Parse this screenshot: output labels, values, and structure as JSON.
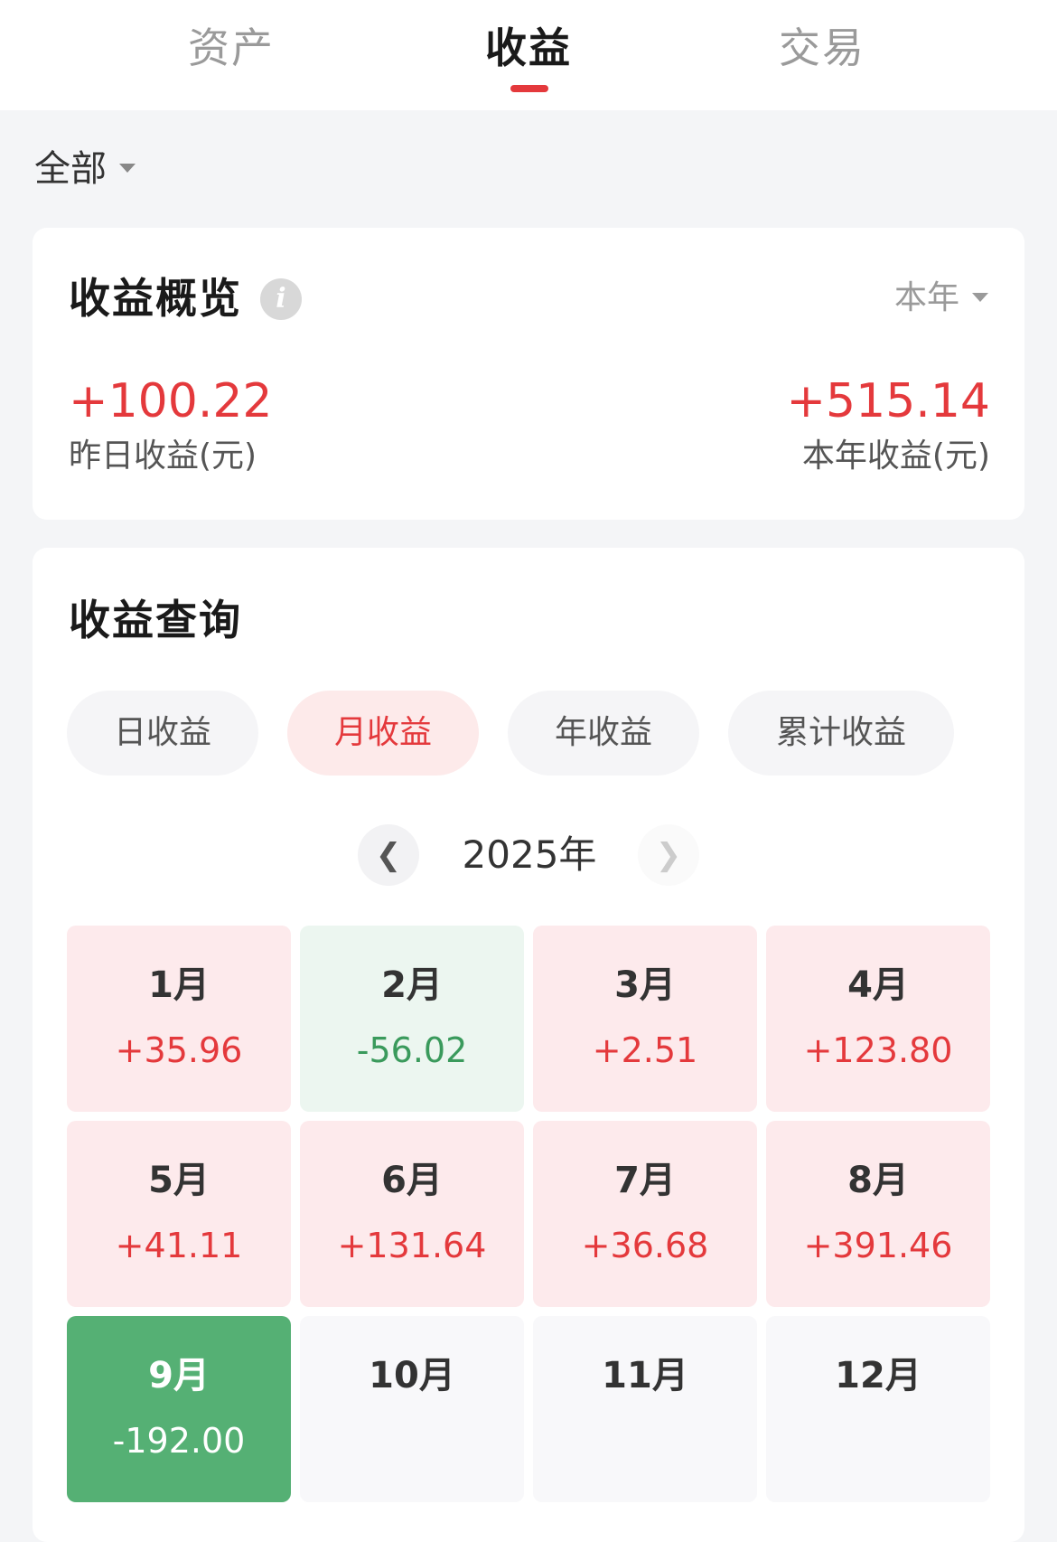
{
  "tabs": [
    {
      "label": "资产",
      "active": false
    },
    {
      "label": "收益",
      "active": true
    },
    {
      "label": "交易",
      "active": false
    }
  ],
  "filter": {
    "label": "全部"
  },
  "overview": {
    "title": "收益概览",
    "info_icon": "info-icon",
    "period": "本年",
    "yesterday": {
      "value": "+100.22",
      "label": "昨日收益(元)"
    },
    "this_year": {
      "value": "+515.14",
      "label": "本年收益(元)"
    }
  },
  "query": {
    "title": "收益查询",
    "pills": [
      {
        "label": "日收益",
        "active": false
      },
      {
        "label": "月收益",
        "active": true
      },
      {
        "label": "年收益",
        "active": false
      },
      {
        "label": "累计收益",
        "active": false
      }
    ],
    "year": "2025年",
    "prev_icon": "chevron-left-icon",
    "next_icon": "chevron-right-icon",
    "months": [
      {
        "name": "1月",
        "value": "+35.96",
        "state": "pos"
      },
      {
        "name": "2月",
        "value": "-56.02",
        "state": "neg"
      },
      {
        "name": "3月",
        "value": "+2.51",
        "state": "pos"
      },
      {
        "name": "4月",
        "value": "+123.80",
        "state": "pos"
      },
      {
        "name": "5月",
        "value": "+41.11",
        "state": "pos"
      },
      {
        "name": "6月",
        "value": "+131.64",
        "state": "pos"
      },
      {
        "name": "7月",
        "value": "+36.68",
        "state": "pos"
      },
      {
        "name": "8月",
        "value": "+391.46",
        "state": "pos"
      },
      {
        "name": "9月",
        "value": "-192.00",
        "state": "current"
      },
      {
        "name": "10月",
        "value": "",
        "state": "empty"
      },
      {
        "name": "11月",
        "value": "",
        "state": "empty"
      },
      {
        "name": "12月",
        "value": "",
        "state": "empty"
      }
    ]
  },
  "colors": {
    "accent_red": "#e4393c",
    "positive_bg": "#fdeaec",
    "negative_text": "#3a9a5c",
    "negative_bg": "#ecf6f0",
    "current_bg": "#55b074"
  }
}
